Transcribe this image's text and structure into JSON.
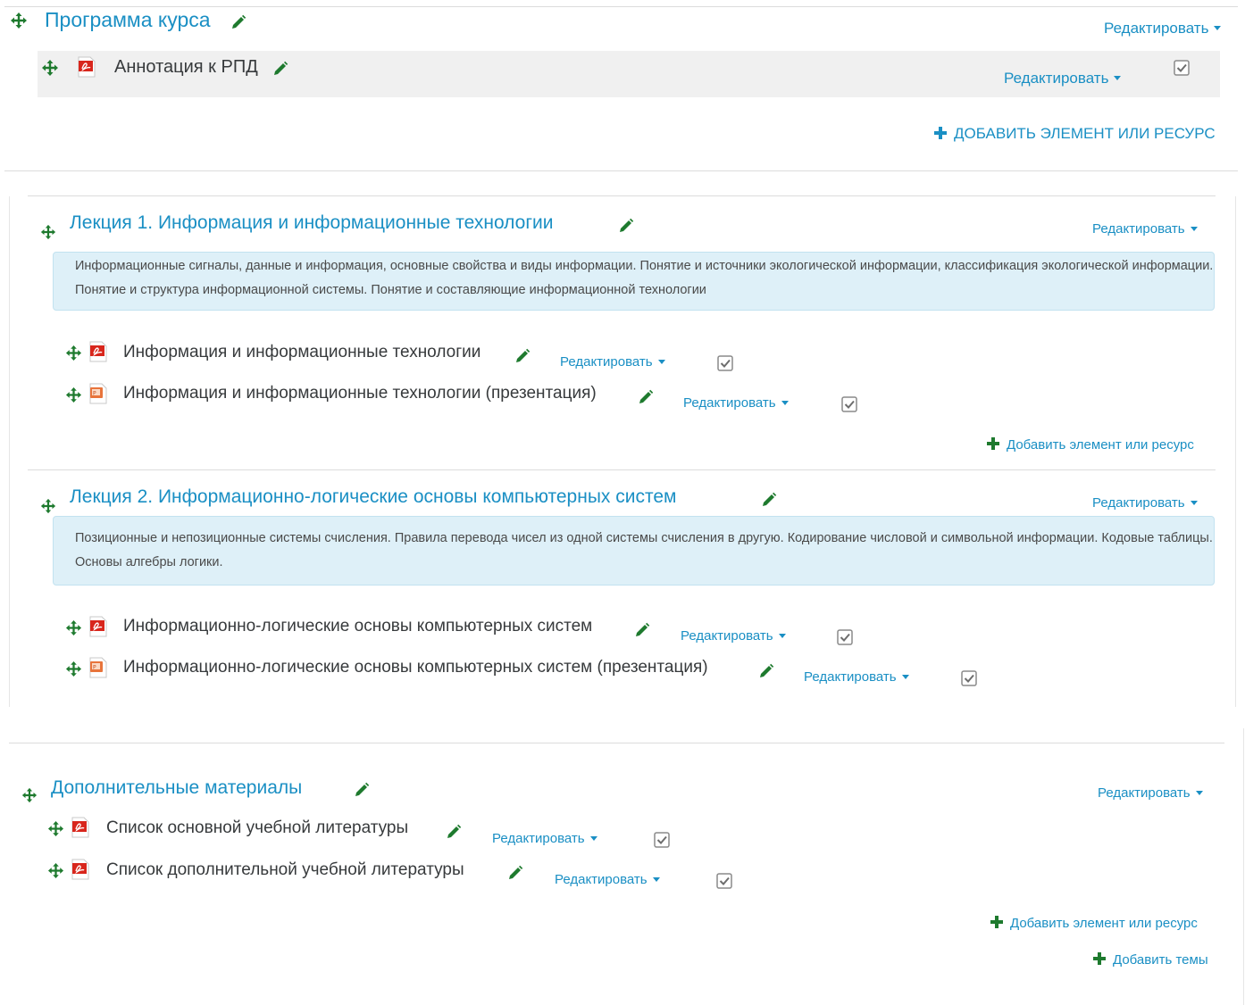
{
  "sections": [
    {
      "title": "Программа курса",
      "edit_label": "Редактировать",
      "activities": [
        {
          "title": "Аннотация к РПД",
          "icon": "pdf-icon",
          "edit_label": "Редактировать"
        }
      ],
      "add_label": "ДОБАВИТЬ ЭЛЕМЕНТ ИЛИ РЕСУРС"
    },
    {
      "title": "Лекция 1. Информация и информационные технологии",
      "edit_label": "Редактировать",
      "summary": "Информационные сигналы, данные и информация, основные свойства и виды информации. Понятие и источники экологической информации, классификация экологической информации. Понятие и структура информационной системы. Понятие и составляющие информационной технологии",
      "activities": [
        {
          "title": "Информация и информационные технологии",
          "icon": "pdf-icon",
          "edit_label": "Редактировать"
        },
        {
          "title": "Информация и информационные технологии (презентация)",
          "icon": "powerpoint-icon",
          "edit_label": "Редактировать"
        }
      ],
      "add_label": "Добавить элемент или ресурс"
    },
    {
      "title": "Лекция 2. Информационно-логические основы компьютерных систем",
      "edit_label": "Редактировать",
      "summary": "Позиционные и непозиционные системы счисления. Правила перевода чисел из одной системы счисления в другую. Кодирование числовой и символьной информации. Кодовые таблицы. Основы алгебры логики.",
      "activities": [
        {
          "title": "Информационно-логические основы компьютерных систем",
          "icon": "pdf-icon",
          "edit_label": "Редактировать"
        },
        {
          "title": "Информационно-логические основы компьютерных систем (презентация)",
          "icon": "powerpoint-icon",
          "edit_label": "Редактировать"
        }
      ]
    },
    {
      "title": "Дополнительные материалы",
      "edit_label": "Редактировать",
      "activities": [
        {
          "title": "Список основной учебной литературы",
          "icon": "pdf-icon",
          "edit_label": "Редактировать"
        },
        {
          "title": "Список дополнительной учебной литературы",
          "icon": "pdf-icon",
          "edit_label": "Редактировать"
        }
      ],
      "add_label": "Добавить элемент или ресурс"
    }
  ],
  "add_topics_label": "Добавить темы",
  "colors": {
    "link": "#1a8fc4",
    "icon_green": "#1e7a2e",
    "summary_bg": "#def0f8"
  }
}
